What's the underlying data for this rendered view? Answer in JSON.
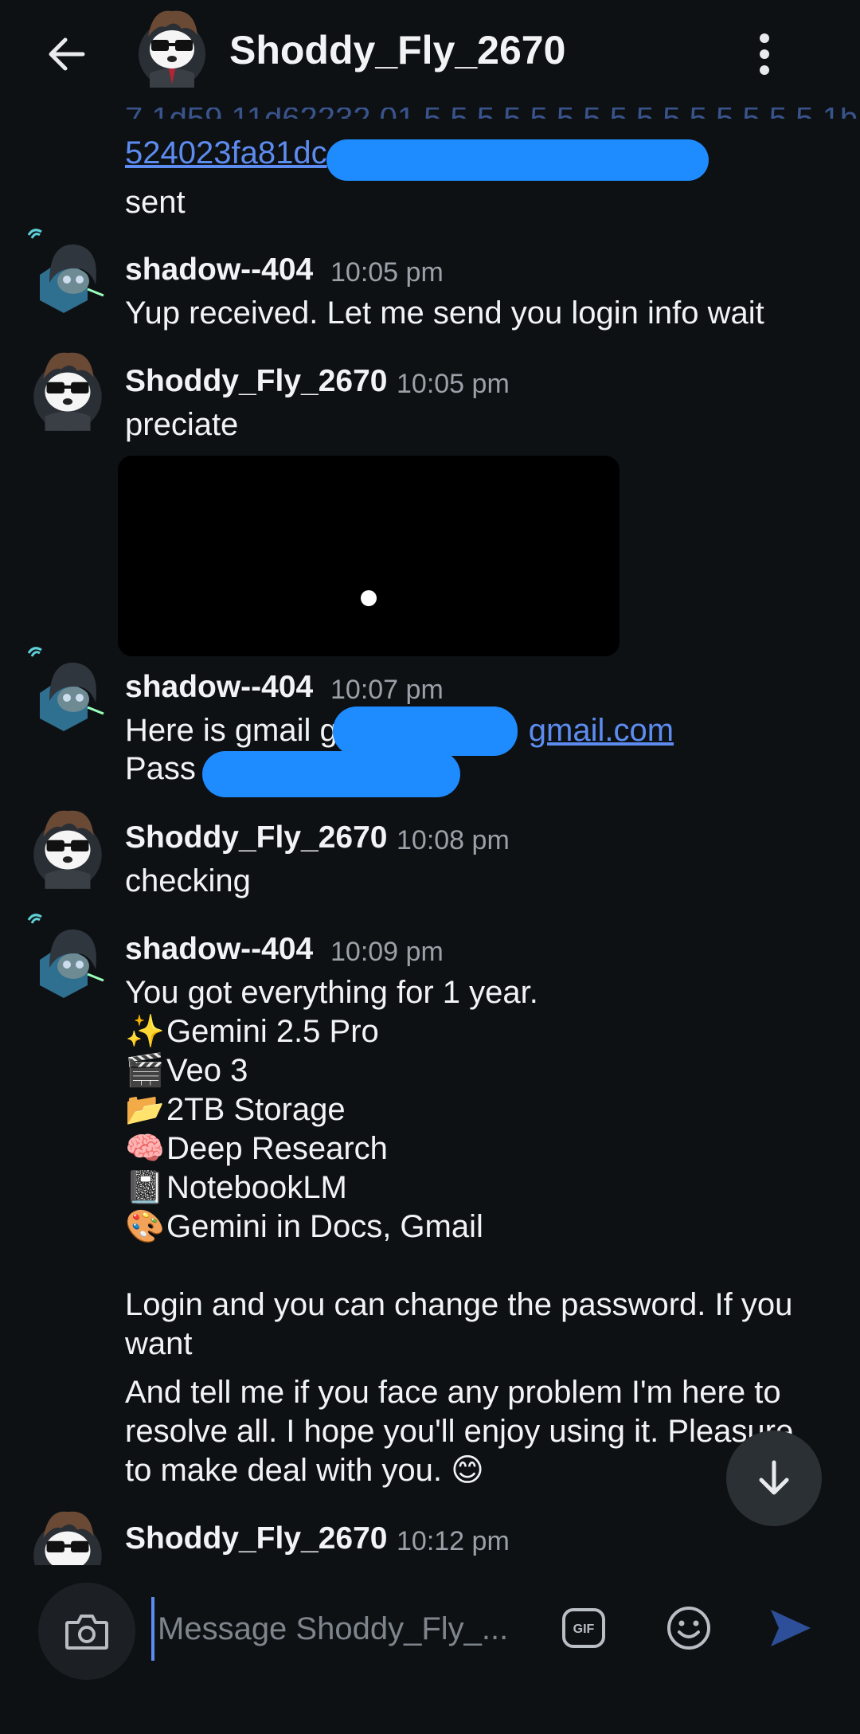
{
  "header": {
    "title": "Shoddy_Fly_2670",
    "back_icon": "arrow-left-icon",
    "more_icon": "more-vertical-icon"
  },
  "colors": {
    "background": "#0e1114",
    "link": "#5d8cf0",
    "redaction": "#1e8bff",
    "timestamp": "#9ba1a8"
  },
  "messages": {
    "partial_top": {
      "link_line": "524023fa81dc",
      "text": "sent"
    },
    "m1": {
      "author": "shadow--404",
      "time": "10:05 pm",
      "lines": [
        "Yup received. Let me send you login info wait"
      ]
    },
    "m2": {
      "author": "Shoddy_Fly_2670",
      "time": "10:05 pm",
      "lines": [
        "preciate"
      ]
    },
    "m3": {
      "author": "shadow--404",
      "time": "10:07 pm",
      "gmail_prefix": "Here is gmail g",
      "gmail_link": "gmail.com",
      "pass_label": "Pass"
    },
    "m4": {
      "author": "Shoddy_Fly_2670",
      "time": "10:08 pm",
      "lines": [
        "checking"
      ]
    },
    "m5": {
      "author": "shadow--404",
      "time": "10:09 pm",
      "intro": "You got everything for 1 year.",
      "features": [
        {
          "emoji": "✨",
          "text": "Gemini 2.5 Pro"
        },
        {
          "emoji": "🎬",
          "text": "Veo 3"
        },
        {
          "emoji": "📂",
          "text": "2TB Storage"
        },
        {
          "emoji": "🧠",
          "text": "Deep Research"
        },
        {
          "emoji": "📓",
          "text": "NotebookLM"
        },
        {
          "emoji": "🎨",
          "text": "Gemini in Docs, Gmail"
        }
      ],
      "para1": [
        "Login and you can change the password. If you",
        "want"
      ],
      "para2": [
        "And tell me if you face any problem I'm here to",
        "resolve all. I hope you'll enjoy using it. Pleasure",
        "to make deal with you. 😊"
      ]
    },
    "m6": {
      "author": "Shoddy_Fly_2670",
      "time": "10:12 pm"
    }
  },
  "scroll_down": {
    "icon": "arrow-down-icon"
  },
  "composer": {
    "placeholder": "Message Shoddy_Fly_...",
    "camera_icon": "camera-icon",
    "gif_label": "GIF",
    "emoji_icon": "smiley-icon",
    "send_icon": "send-icon"
  }
}
